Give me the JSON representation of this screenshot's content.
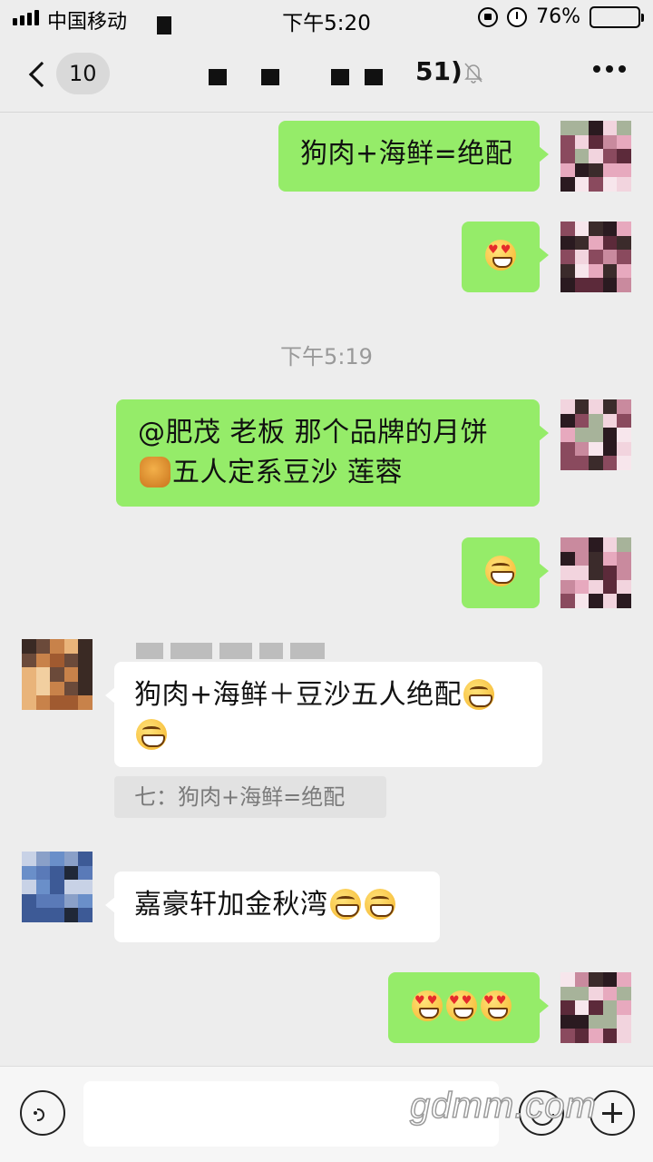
{
  "status_bar": {
    "carrier": "中国移动",
    "time": "下午5:20",
    "battery_percent": "76%",
    "battery_level": 0.76
  },
  "nav": {
    "unread_count": "10",
    "title_suffix": "51)"
  },
  "messages": [
    {
      "from": "me",
      "text": "狗肉+海鲜=绝配"
    },
    {
      "from": "me",
      "emoji": [
        "love"
      ]
    },
    {
      "type": "time",
      "text": "下午5:19"
    },
    {
      "from": "me",
      "text_line1": "@肥茂 老板 那个品牌的月饼",
      "text_line2": "五人定系豆沙 莲蓉",
      "emoji": [
        "mooncake"
      ]
    },
    {
      "from": "me",
      "emoji": [
        "grin"
      ]
    },
    {
      "from": "other",
      "text": "狗肉+海鲜＋豆沙五人绝配",
      "emoji": [
        "grin",
        "grin"
      ],
      "quote": "七：狗肉+海鲜=绝配"
    },
    {
      "from": "other",
      "text": "嘉豪轩加金秋湾",
      "emoji": [
        "grin",
        "grin"
      ]
    },
    {
      "from": "me",
      "emoji": [
        "love",
        "love",
        "love"
      ]
    }
  ],
  "input_bar": {
    "placeholder": ""
  },
  "watermark": "gdmm.com",
  "colors": {
    "outgoing_bubble": "#95ec69",
    "incoming_bubble": "#ffffff",
    "background": "#ededed"
  }
}
